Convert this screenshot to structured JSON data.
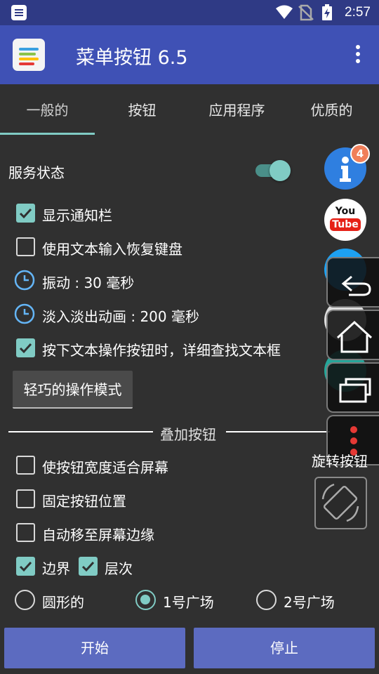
{
  "status_bar": {
    "time": "2:57"
  },
  "app_bar": {
    "title": "菜单按钮 6.5"
  },
  "tabs": [
    {
      "label": "一般的"
    },
    {
      "label": "按钮"
    },
    {
      "label": "应用程序"
    },
    {
      "label": "优质的"
    }
  ],
  "general": {
    "service_status_label": "服务状态",
    "service_enabled": true,
    "options": [
      {
        "label": "显示通知栏",
        "checked": true
      },
      {
        "label": "使用文本输入恢复键盘",
        "checked": false
      },
      {
        "label": "按下文本操作按钮时，详细查找文本框",
        "checked": true
      }
    ],
    "vibration_label": "振动 : 30 毫秒",
    "fade_label": "淡入淡出动画 : 200 毫秒",
    "mode_button": "轻巧的操作模式"
  },
  "overlay_section": {
    "header": "叠加按钮",
    "options": [
      {
        "label": "使按钮宽度适合屏幕",
        "checked": false
      },
      {
        "label": "固定按钮位置",
        "checked": false
      },
      {
        "label": "自动移至屏幕边缘",
        "checked": false
      }
    ],
    "border_label": "边界",
    "border_checked": true,
    "layer_label": "层次",
    "layer_checked": true,
    "shapes": [
      {
        "label": "圆形的",
        "selected": false
      },
      {
        "label": "1号广场",
        "selected": true
      },
      {
        "label": "2号广场",
        "selected": false
      }
    ]
  },
  "floating": {
    "info_badge": "4",
    "youtube_top": "You",
    "youtube_bottom": "Tube",
    "rotate_label": "旋转按钮"
  },
  "bottom": {
    "start": "开始",
    "stop": "停止"
  },
  "colors": {
    "accent": "#80cbc4",
    "primary": "#3f51b5",
    "status": "#2f3a85",
    "button": "#5c6bc0"
  }
}
